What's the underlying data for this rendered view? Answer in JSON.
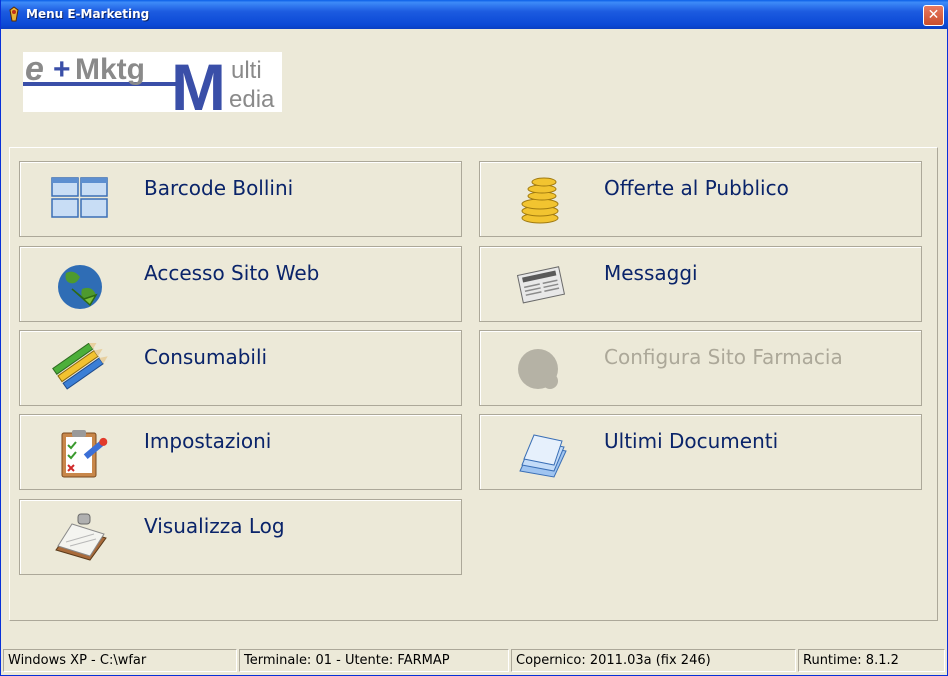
{
  "window": {
    "title": "Menu E-Marketing",
    "close_glyph": "✕"
  },
  "logo": {
    "part1": "e",
    "plus": "+",
    "part2": "Mktg",
    "big_letter": "M",
    "word1": "ulti",
    "word2": "edia"
  },
  "menu": {
    "left": [
      {
        "label": "Barcode Bollini",
        "icon": "grid-icon"
      },
      {
        "label": "Accesso Sito Web",
        "icon": "globe-icon"
      },
      {
        "label": "Consumabili",
        "icon": "pencils-icon"
      },
      {
        "label": "Impostazioni",
        "icon": "clipboard-checklist-icon"
      },
      {
        "label": "Visualizza Log",
        "icon": "notepad-icon"
      }
    ],
    "right": [
      {
        "label": "Offerte al Pubblico",
        "icon": "coins-icon"
      },
      {
        "label": "Messaggi",
        "icon": "newspaper-icon"
      },
      {
        "label": "Configura Sito Farmacia",
        "icon": "disabled-gear-icon",
        "disabled": true
      },
      {
        "label": "Ultimi Documenti",
        "icon": "documents-stack-icon"
      }
    ]
  },
  "statusbar": {
    "os": "Windows XP - C:\\wfar",
    "terminal": "Terminale: 01 - Utente: FARMAP",
    "version": "Copernico: 2011.03a (fix 246)",
    "runtime": "Runtime: 8.1.2"
  },
  "colors": {
    "label": "#0A246A",
    "disabled_label": "#ACA899",
    "window_bg": "#ECE9D8",
    "titlebar": "#0B49D6"
  }
}
